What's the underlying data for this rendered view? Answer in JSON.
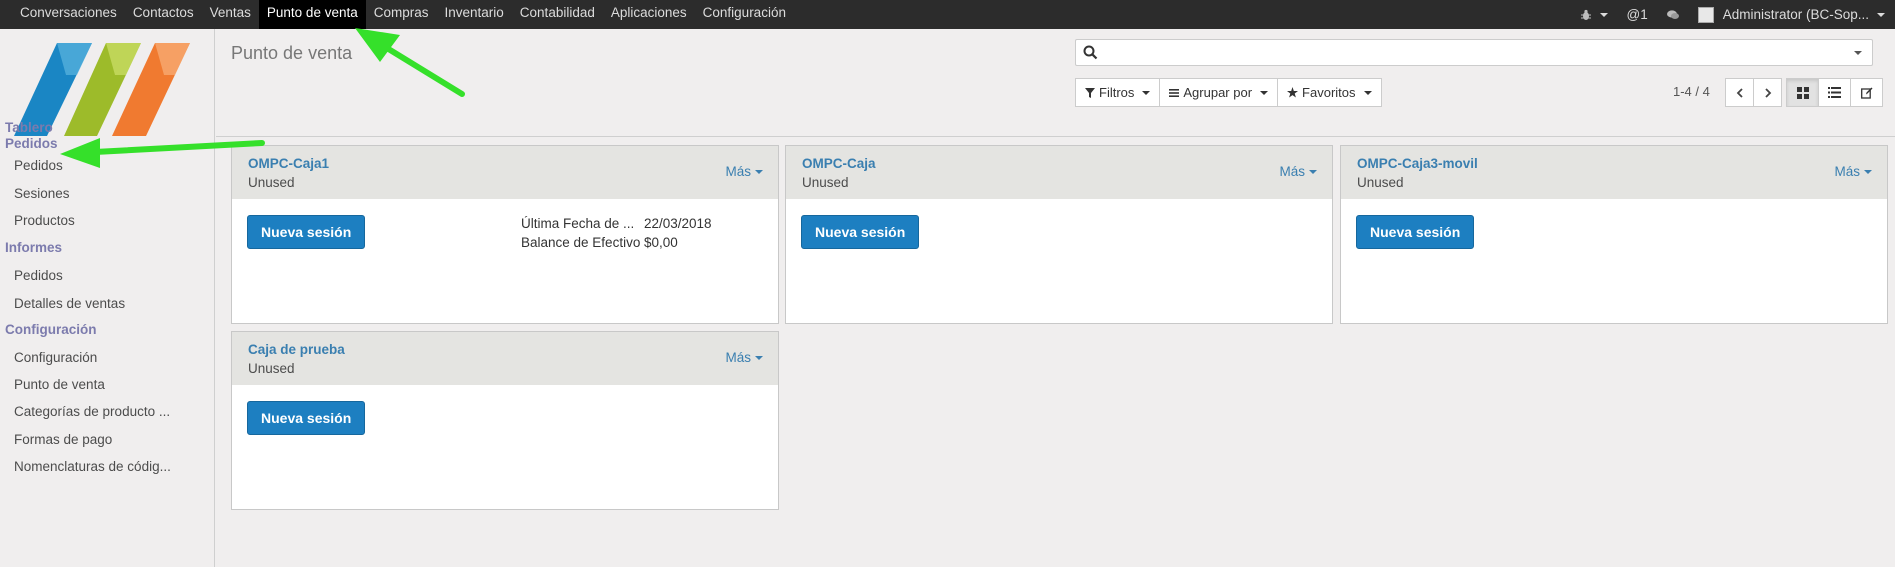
{
  "menu": [
    "Conversaciones",
    "Contactos",
    "Ventas",
    "Punto de venta",
    "Compras",
    "Inventario",
    "Contabilidad",
    "Aplicaciones",
    "Configuración"
  ],
  "menu_active_index": 3,
  "systray": {
    "notifications": "@1",
    "user": "Administrator (BC-Sop..."
  },
  "sidebar": {
    "dashboard": "Tablero",
    "orders_section": "Pedidos",
    "orders_items": [
      "Pedidos",
      "Sesiones",
      "Productos"
    ],
    "reports_section": "Informes",
    "reports_items": [
      "Pedidos",
      "Detalles de ventas"
    ],
    "config_section": "Configuración",
    "config_items": [
      "Configuración",
      "Punto de venta",
      "Categorías de producto ...",
      "Formas de pago",
      "Nomenclaturas de códig..."
    ]
  },
  "breadcrumb": "Punto de venta",
  "search": {
    "placeholder": "",
    "value": ""
  },
  "filters": {
    "filters_label": "Filtros",
    "groupby_label": "Agrupar por",
    "favorites_label": "Favoritos"
  },
  "pager": "1-4 / 4",
  "cards": [
    {
      "title": "OMPC-Caja1",
      "status": "Unused",
      "more": "Más",
      "button": "Nueva sesión",
      "info": [
        {
          "label": "Última Fecha de ...",
          "value": "22/03/2018"
        },
        {
          "label": "Balance de Efectivo",
          "value": "$0,00"
        }
      ]
    },
    {
      "title": "OMPC-Caja",
      "status": "Unused",
      "more": "Más",
      "button": "Nueva sesión",
      "info": []
    },
    {
      "title": "OMPC-Caja3-movil",
      "status": "Unused",
      "more": "Más",
      "button": "Nueva sesión",
      "info": []
    },
    {
      "title": "Caja de prueba",
      "status": "Unused",
      "more": "Más",
      "button": "Nueva sesión",
      "info": []
    }
  ],
  "colors": {
    "topbar": "#2c2c2c",
    "accent": "#7c7bad",
    "link": "#3a7fb0",
    "primary_button": "#1d7fc1",
    "annotation_arrow": "#35e02a"
  },
  "icons": {
    "bug": "bug-icon",
    "chat": "chat-icon",
    "search": "search-icon",
    "filter": "filter-icon",
    "groupby": "list-icon",
    "favorites": "star-icon",
    "kanban": "kanban-icon",
    "list": "list-view-icon",
    "edit": "edit-icon"
  }
}
